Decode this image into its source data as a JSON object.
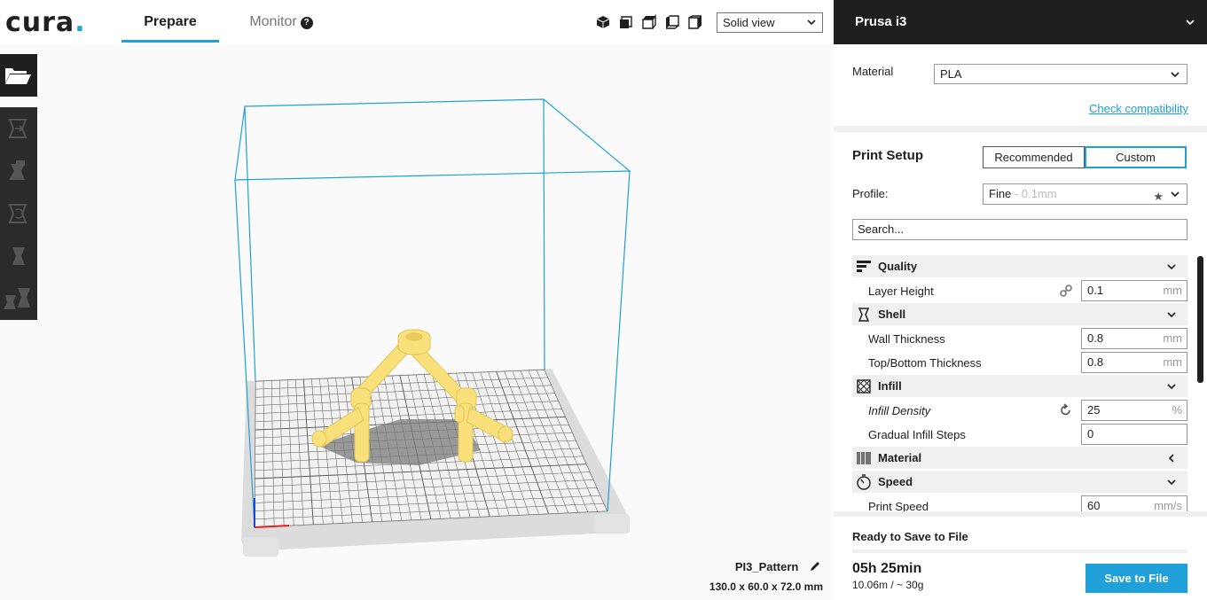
{
  "app": {
    "logo": "cura",
    "logo_dot": "."
  },
  "tabs": {
    "prepare": "Prepare",
    "monitor": "Monitor",
    "monitor_help": "?"
  },
  "view": {
    "mode": "Solid view"
  },
  "viewport": {
    "object_name": "PI3_Pattern",
    "object_dims": "130.0 x 60.0 x 72.0 mm"
  },
  "machine": {
    "name": "Prusa i3"
  },
  "material": {
    "label": "Material",
    "value": "PLA",
    "compat_link": "Check compatibility"
  },
  "setup": {
    "title": "Print Setup",
    "mode_recommended": "Recommended",
    "mode_custom": "Custom",
    "profile_label": "Profile:",
    "profile_value": "Fine",
    "profile_sub": " - 0.1mm",
    "search_placeholder": "Search..."
  },
  "settings": {
    "quality": {
      "label": "Quality",
      "layer_height": {
        "label": "Layer Height",
        "value": "0.1",
        "unit": "mm"
      }
    },
    "shell": {
      "label": "Shell",
      "wall_thickness": {
        "label": "Wall Thickness",
        "value": "0.8",
        "unit": "mm"
      },
      "topbottom": {
        "label": "Top/Bottom Thickness",
        "value": "0.8",
        "unit": "mm"
      }
    },
    "infill": {
      "label": "Infill",
      "density": {
        "label": "Infill Density",
        "value": "25",
        "unit": "%"
      },
      "gradual": {
        "label": "Gradual Infill Steps",
        "value": "0"
      }
    },
    "material": {
      "label": "Material"
    },
    "speed": {
      "label": "Speed",
      "print_speed": {
        "label": "Print Speed",
        "value": "60",
        "unit": "mm/s"
      }
    }
  },
  "footer": {
    "status": "Ready to Save to File",
    "time": "05h 25min",
    "material_usage": "10.06m / ~ 30g",
    "save_button": "Save to File"
  },
  "colors": {
    "accent": "#1fa0d8",
    "dark": "#1f1f1f",
    "model": "#f9e07a"
  }
}
